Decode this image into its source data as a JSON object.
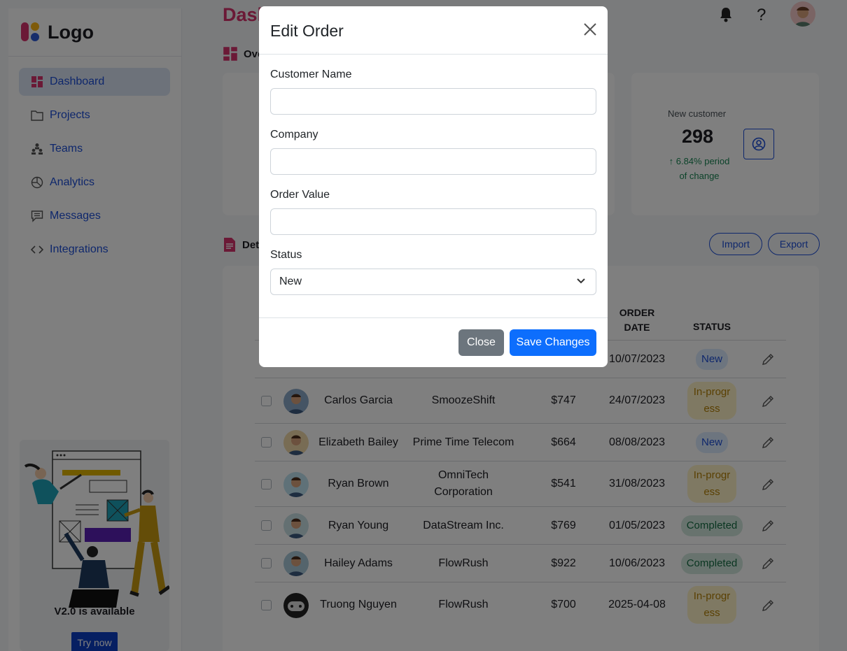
{
  "sidebar": {
    "logo_text": "Logo",
    "items": [
      {
        "label": "Dashboard",
        "icon": "dashboard-icon",
        "active": true
      },
      {
        "label": "Projects",
        "icon": "folder-icon"
      },
      {
        "label": "Teams",
        "icon": "teams-icon"
      },
      {
        "label": "Analytics",
        "icon": "pie-chart-icon"
      },
      {
        "label": "Messages",
        "icon": "message-icon"
      },
      {
        "label": "Integrations",
        "icon": "code-icon"
      }
    ],
    "promo": {
      "title": "V2.0 is available",
      "button": "Try now"
    }
  },
  "header": {
    "title": "Dashboard"
  },
  "overview": {
    "heading": "Overview",
    "new_customer": {
      "label": "New customer",
      "value": "298",
      "change_line1": "↑ 6.84% period",
      "change_line2": "of change"
    }
  },
  "details": {
    "heading": "Detailed report",
    "import_label": "Import",
    "export_label": "Export",
    "columns": {
      "order_date_1": "ORDER",
      "order_date_2": "DATE",
      "status": "STATUS"
    },
    "first_row": {
      "date": "10/07/2023",
      "status": "New"
    },
    "rows": [
      {
        "name": "Carlos Garcia",
        "company": "SmoozeShift",
        "value": "$747",
        "date": "24/07/2023",
        "status": "In-progress",
        "status_type": "progress"
      },
      {
        "name": "Elizabeth Bailey",
        "company": "Prime Time Telecom",
        "value": "$664",
        "date": "08/08/2023",
        "status": "New",
        "status_type": "new"
      },
      {
        "name": "Ryan Brown",
        "company": "OmniTech Corporation",
        "value": "$541",
        "date": "31/08/2023",
        "status": "In-progress",
        "status_type": "progress"
      },
      {
        "name": "Ryan Young",
        "company": "DataStream Inc.",
        "value": "$769",
        "date": "01/05/2023",
        "status": "Completed",
        "status_type": "completed"
      },
      {
        "name": "Hailey Adams",
        "company": "FlowRush",
        "value": "$922",
        "date": "10/06/2023",
        "status": "Completed",
        "status_type": "completed"
      },
      {
        "name": "Truong Nguyen",
        "company": "FlowRush",
        "value": "$700",
        "date": "2025-04-08",
        "status": "In-progress",
        "status_type": "progress"
      }
    ]
  },
  "modal": {
    "title": "Edit Order",
    "fields": {
      "customer_name": {
        "label": "Customer Name",
        "value": ""
      },
      "company": {
        "label": "Company",
        "value": ""
      },
      "order_value": {
        "label": "Order Value",
        "value": ""
      },
      "status": {
        "label": "Status",
        "value": "New"
      }
    },
    "close_label": "Close",
    "save_label": "Save Changes"
  },
  "colors": {
    "accent": "#d6336c",
    "primary": "#1d4ed8",
    "save": "#0d6efd",
    "close": "#6c757d"
  }
}
